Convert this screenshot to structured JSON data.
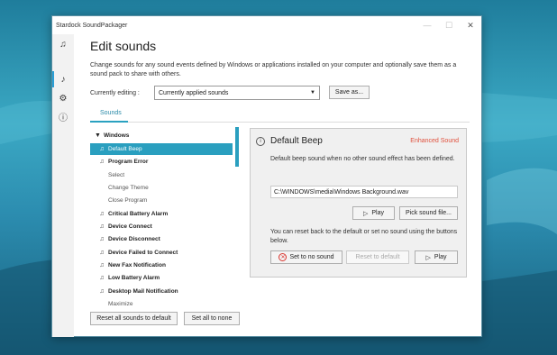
{
  "window": {
    "title": "Stardock SoundPackager",
    "minimize_glyph": "—",
    "maximize_glyph": "☐",
    "close_glyph": "✕"
  },
  "nav": {
    "icons": [
      "music-notes-icon",
      "edit-sounds-icon",
      "settings-gear-icon",
      "info-icon"
    ],
    "glyphs": [
      "♫",
      "♪",
      "⚙",
      "ⓘ"
    ]
  },
  "main": {
    "heading": "Edit sounds",
    "description": "Change sounds for any sound events defined by Windows or applications installed on your computer and optionally save them as a sound pack to share with others.",
    "currently_editing_label": "Currently editing :",
    "currently_editing_value": "Currently applied sounds",
    "save_as_label": "Save as...",
    "tab_label": "Sounds"
  },
  "tree": {
    "items": [
      {
        "label": "Windows",
        "kind": "group"
      },
      {
        "label": "Default Beep",
        "kind": "sound",
        "selected": true
      },
      {
        "label": "Program Error",
        "kind": "sound-bold"
      },
      {
        "label": "Select",
        "kind": "sub"
      },
      {
        "label": "Change Theme",
        "kind": "sub"
      },
      {
        "label": "Close Program",
        "kind": "sub"
      },
      {
        "label": "Critical Battery Alarm",
        "kind": "sound-bold"
      },
      {
        "label": "Device Connect",
        "kind": "sound-bold"
      },
      {
        "label": "Device Disconnect",
        "kind": "sound-bold"
      },
      {
        "label": "Device Failed to Connect",
        "kind": "sound-bold"
      },
      {
        "label": "New Fax Notification",
        "kind": "sound-bold"
      },
      {
        "label": "Low Battery Alarm",
        "kind": "sound-bold"
      },
      {
        "label": "Desktop Mail Notification",
        "kind": "sound-bold"
      },
      {
        "label": "Maximize",
        "kind": "sub"
      }
    ],
    "reset_all_label": "Reset all sounds to default",
    "set_all_none_label": "Set all to none"
  },
  "detail": {
    "title": "Default Beep",
    "badge": "Enhanced Sound",
    "badge_color": "#e0503c",
    "description": "Default beep sound when no other sound effect has been defined.",
    "file_path": "C:\\WINDOWS\\media\\Windows Background.wav",
    "play_label": "Play",
    "pick_label": "Pick sound file...",
    "reset_text": "You can reset back to the default or set no sound using the buttons below.",
    "set_none_label": "Set to no sound",
    "reset_default_label": "Reset to default",
    "play2_label": "Play"
  },
  "colors": {
    "accent": "#2a9fbf",
    "tab_text": "#2a8aa8"
  }
}
